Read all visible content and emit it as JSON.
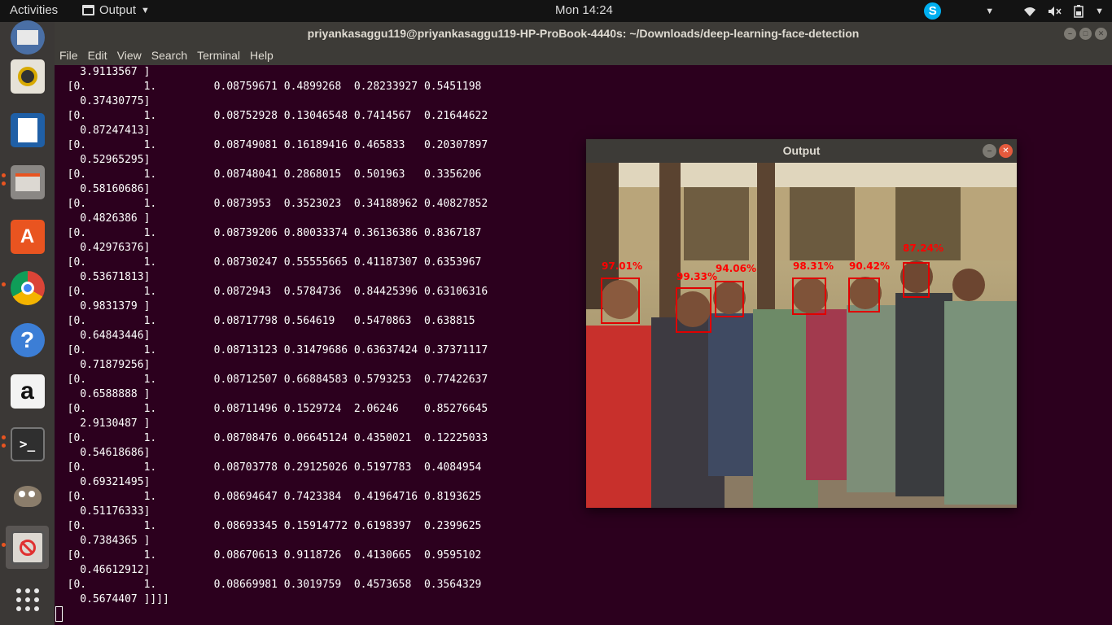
{
  "topbar": {
    "activities": "Activities",
    "app_menu": "Output",
    "clock": "Mon 14:24",
    "skype_letter": "S"
  },
  "dock": {
    "items": [
      {
        "name": "thunderbird-icon"
      },
      {
        "name": "rhythmbox-icon"
      },
      {
        "name": "writer-icon"
      },
      {
        "name": "files-icon"
      },
      {
        "name": "software-icon"
      },
      {
        "name": "chrome-icon"
      },
      {
        "name": "help-icon",
        "glyph": "?"
      },
      {
        "name": "amazon-icon",
        "glyph": "a"
      },
      {
        "name": "terminal-icon",
        "glyph": ">_"
      },
      {
        "name": "gimp-icon"
      },
      {
        "name": "output-window-icon"
      },
      {
        "name": "show-apps-icon"
      }
    ]
  },
  "terminal": {
    "title": "priyankasaggu119@priyankasaggu119-HP-ProBook-4440s: ~/Downloads/deep-learning-face-detection",
    "menu": [
      "File",
      "Edit",
      "View",
      "Search",
      "Terminal",
      "Help"
    ],
    "lines": [
      "    3.9113567 ]",
      "  [0.         1.         0.08759671 0.4899268  0.28233927 0.5451198",
      "    0.37430775]",
      "  [0.         1.         0.08752928 0.13046548 0.7414567  0.21644622",
      "    0.87247413]",
      "  [0.         1.         0.08749081 0.16189416 0.465833   0.20307897",
      "    0.52965295]",
      "  [0.         1.         0.08748041 0.2868015  0.501963   0.3356206",
      "    0.58160686]",
      "  [0.         1.         0.0873953  0.3523023  0.34188962 0.40827852",
      "    0.4826386 ]",
      "  [0.         1.         0.08739206 0.80033374 0.36136386 0.8367187",
      "    0.42976376]",
      "  [0.         1.         0.08730247 0.55555665 0.41187307 0.6353967",
      "    0.53671813]",
      "  [0.         1.         0.0872943  0.5784736  0.84425396 0.63106316",
      "    0.9831379 ]",
      "  [0.         1.         0.08717798 0.564619   0.5470863  0.638815",
      "    0.64843446]",
      "  [0.         1.         0.08713123 0.31479686 0.63637424 0.37371117",
      "    0.71879256]",
      "  [0.         1.         0.08712507 0.66884583 0.5793253  0.77422637",
      "    0.6588888 ]",
      "  [0.         1.         0.08711496 0.1529724  2.06246    0.85276645",
      "    2.9130487 ]",
      "  [0.         1.         0.08708476 0.06645124 0.4350021  0.12225033",
      "    0.54618686]",
      "  [0.         1.         0.08703778 0.29125026 0.5197783  0.4084954",
      "    0.69321495]",
      "  [0.         1.         0.08694647 0.7423384  0.41964716 0.8193625",
      "    0.51176333]",
      "  [0.         1.         0.08693345 0.15914772 0.6198397  0.2399625",
      "    0.7384365 ]",
      "  [0.         1.         0.08670613 0.9118726  0.4130665  0.9595102",
      "    0.46612912]",
      "  [0.         1.         0.08669981 0.3019759  0.4573658  0.3564329",
      "    0.5674407 ]]]]"
    ]
  },
  "output_window": {
    "title": "Output",
    "detections": [
      "97.01%",
      "99.33%",
      "94.06%",
      "98.31%",
      "90.42%",
      "87.24%"
    ]
  }
}
